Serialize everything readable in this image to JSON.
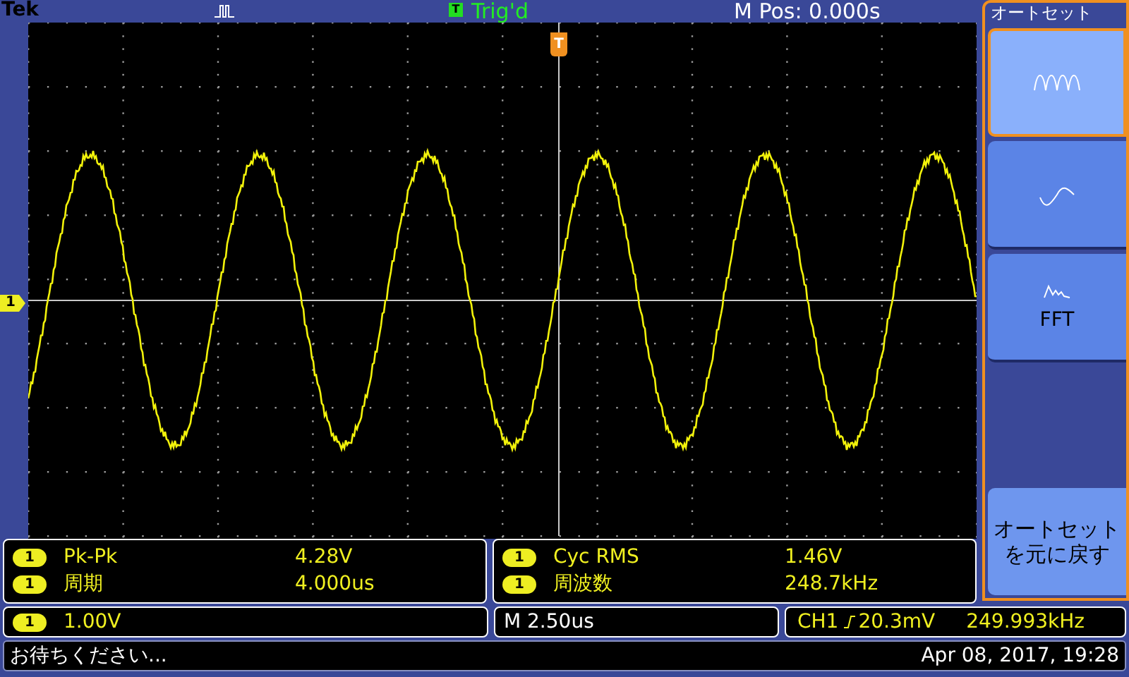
{
  "header": {
    "brand": "Tek",
    "trigger_badge": "T",
    "trigger_status": "Trig'd",
    "position": "M Pos: 0.000s"
  },
  "display": {
    "channel_marker": "1",
    "trigger_marker": "T"
  },
  "side_menu": {
    "title": "オートセット",
    "options": [
      {
        "kind": "multi",
        "selected": true
      },
      {
        "kind": "single",
        "selected": false
      },
      {
        "kind": "fft",
        "label": "FFT",
        "selected": false
      }
    ],
    "undo_button": [
      "オートセット",
      "を元に戻す"
    ]
  },
  "measurement_panels": [
    [
      {
        "channel": "1",
        "name": "Pk-Pk",
        "value": "4.28V"
      },
      {
        "channel": "1",
        "name": "周期",
        "value": "4.000us"
      }
    ],
    [
      {
        "channel": "1",
        "name": "Cyc RMS",
        "value": "1.46V"
      },
      {
        "channel": "1",
        "name": "周波数",
        "value": "248.7kHz"
      }
    ]
  ],
  "settings_bar": {
    "channel": "1",
    "scale": "1.00V",
    "timebase": "M 2.50us",
    "trigger_source": "CH1",
    "trigger_level": "20.3mV",
    "trigger_frequency": "249.993kHz"
  },
  "status_bar": {
    "message": "お待ちください...",
    "datetime": "Apr 08, 2017, 19:28"
  }
}
